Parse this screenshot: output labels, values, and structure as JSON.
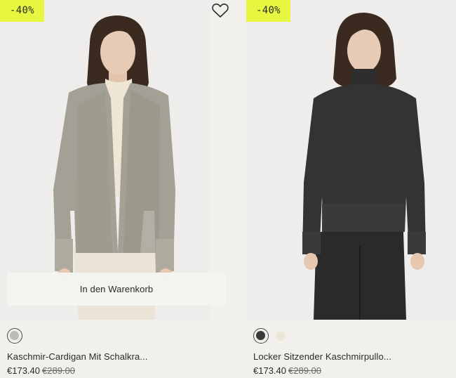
{
  "products": [
    {
      "discount_badge": "-40%",
      "image_alt": "Frau in grauem Kaschmir-Cardigan",
      "add_to_cart_label": "In den Warenkorb",
      "swatches": [
        {
          "color": "#bcbcb6",
          "selected": true
        }
      ],
      "name": "Kaschmir-Cardigan Mit Schalkra...",
      "price_current": "€173.40",
      "price_original": "€289.00"
    },
    {
      "discount_badge": "-40%",
      "image_alt": "Frau in dunklem Kaschmirpullover",
      "swatches": [
        {
          "color": "#3a3a3a",
          "selected": true
        },
        {
          "color": "#ebe6d8",
          "selected": false
        }
      ],
      "name": "Locker Sitzender Kaschmirpullo...",
      "price_current": "€173.40",
      "price_original": "€289.00"
    }
  ],
  "wishlist_icon": "heart-icon"
}
